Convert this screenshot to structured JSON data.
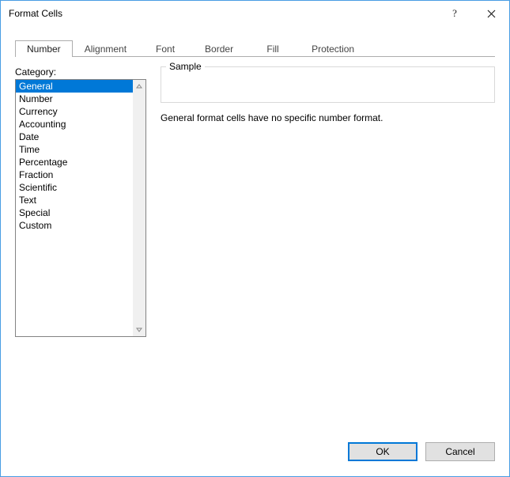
{
  "window": {
    "title": "Format Cells"
  },
  "tabs": [
    {
      "label": "Number",
      "active": true
    },
    {
      "label": "Alignment",
      "active": false
    },
    {
      "label": "Font",
      "active": false
    },
    {
      "label": "Border",
      "active": false
    },
    {
      "label": "Fill",
      "active": false
    },
    {
      "label": "Protection",
      "active": false
    }
  ],
  "category": {
    "label": "Category:",
    "items": [
      "General",
      "Number",
      "Currency",
      "Accounting",
      "Date",
      "Time",
      "Percentage",
      "Fraction",
      "Scientific",
      "Text",
      "Special",
      "Custom"
    ],
    "selected_index": 0
  },
  "sample": {
    "legend": "Sample",
    "value": ""
  },
  "description": "General format cells have no specific number format.",
  "buttons": {
    "ok": "OK",
    "cancel": "Cancel"
  }
}
